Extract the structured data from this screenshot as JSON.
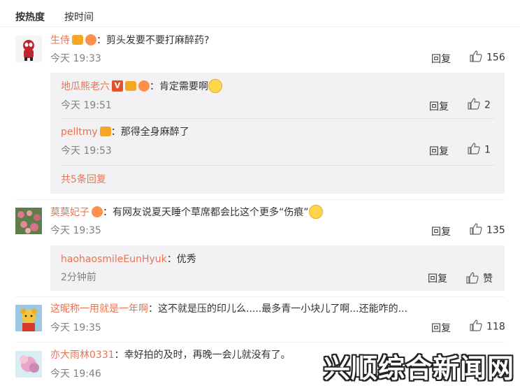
{
  "tabs": {
    "hot": "按热度",
    "time": "按时间"
  },
  "comments": [
    {
      "user": "生侍",
      "colon": "：",
      "text": "剪头发要不要打麻醉药?",
      "time": "今天 19:33",
      "reply": "回复",
      "likes": "156"
    },
    {
      "user": "莫莫妃子",
      "colon": "：",
      "text": "有网友说夏天睡个草席都会比这个更多“伤痕”",
      "time": "今天 19:35",
      "reply": "回复",
      "likes": "135"
    },
    {
      "user": "这昵称一用就是一年啊",
      "colon": "：",
      "text": "这不就是压的印儿么.....最多青一小块儿了啊...还能咋的...",
      "time": "今天 19:35",
      "reply": "回复",
      "likes": "118"
    },
    {
      "user": "亦大雨林0331",
      "colon": "：",
      "text": "幸好拍的及时，再晚一会儿就没有了。",
      "time": "今天 19:46"
    }
  ],
  "subreplies": {
    "c1": [
      {
        "user": "地瓜熊老六",
        "colon": "：",
        "text": "肯定需要啊",
        "time": "今天 19:51",
        "reply": "回复",
        "likes": "2"
      },
      {
        "user": "pelltmy",
        "colon": "：",
        "text": "那得全身麻醉了",
        "time": "今天 19:53",
        "reply": "回复",
        "likes": "1"
      }
    ],
    "c1_more": "共5条回复",
    "c2": [
      {
        "user": "haohaosmileEunHyuk",
        "colon": "：",
        "text": "优秀",
        "time": "2分钟前",
        "reply": "回复",
        "likes": "赞"
      }
    ]
  },
  "watermark": "兴顺综合新闻网",
  "colors": {
    "username": "#eb7350",
    "subbox": "#f2f2f5",
    "time": "#808080"
  }
}
